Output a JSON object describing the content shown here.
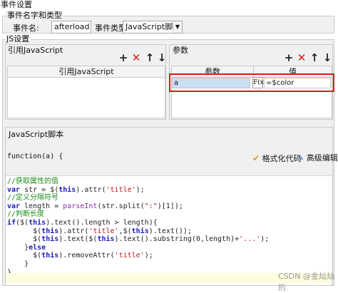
{
  "window": {
    "title": "事件设置"
  },
  "event_group": {
    "legend": "事件名字和类型",
    "name_label": "事件名:",
    "name_value": "afterload",
    "type_label": "事件类型:",
    "type_value": "JavaScript脚本"
  },
  "js_group": {
    "legend": "JS设置",
    "ref_panel": {
      "title": "引用JavaScript",
      "column": "引用JavaScript"
    },
    "param_panel": {
      "title": "参数",
      "columns": [
        "参数",
        "值"
      ],
      "rows": [
        {
          "param": "a",
          "fx": "F(x)",
          "value": "=$color"
        }
      ]
    },
    "toolbar": {
      "add": "+",
      "remove": "✕",
      "up": "↑",
      "down": "↓"
    },
    "script_title": "JavaScript脚本",
    "func_signature": "function(a) {",
    "format_label": "格式化代码",
    "advanced_label": "高级编辑"
  },
  "code_lines": [
    {
      "tokens": [
        {
          "t": "cm",
          "v": "//获取属性的值"
        }
      ]
    },
    {
      "tokens": [
        {
          "t": "kw",
          "v": "var"
        },
        {
          "t": "plain",
          "v": " str = $("
        },
        {
          "t": "kw",
          "v": "this"
        },
        {
          "t": "plain",
          "v": ").attr("
        },
        {
          "t": "st",
          "v": "'title'"
        },
        {
          "t": "plain",
          "v": ");"
        }
      ]
    },
    {
      "tokens": [
        {
          "t": "cm",
          "v": "//定义分隔符号"
        }
      ]
    },
    {
      "tokens": [
        {
          "t": "kw",
          "v": "var"
        },
        {
          "t": "plain",
          "v": " length = "
        },
        {
          "t": "fn",
          "v": "parseInt"
        },
        {
          "t": "plain",
          "v": "(str.split("
        },
        {
          "t": "st",
          "v": "\":\""
        },
        {
          "t": "plain",
          "v": ")[1]);"
        }
      ]
    },
    {
      "tokens": [
        {
          "t": "cm",
          "v": "//判断长度"
        }
      ]
    },
    {
      "tokens": [
        {
          "t": "kw",
          "v": "if"
        },
        {
          "t": "plain",
          "v": "($("
        },
        {
          "t": "kw",
          "v": "this"
        },
        {
          "t": "plain",
          "v": ").text().length > length){"
        }
      ]
    },
    {
      "tokens": [
        {
          "t": "plain",
          "v": "      $("
        },
        {
          "t": "kw",
          "v": "this"
        },
        {
          "t": "plain",
          "v": ").attr("
        },
        {
          "t": "st",
          "v": "'title'"
        },
        {
          "t": "plain",
          "v": ",$("
        },
        {
          "t": "kw",
          "v": "this"
        },
        {
          "t": "plain",
          "v": ").text());"
        }
      ]
    },
    {
      "tokens": [
        {
          "t": "plain",
          "v": "      $("
        },
        {
          "t": "kw",
          "v": "this"
        },
        {
          "t": "plain",
          "v": ").text($("
        },
        {
          "t": "kw",
          "v": "this"
        },
        {
          "t": "plain",
          "v": ").text().substring(0,length)+"
        },
        {
          "t": "st",
          "v": "'...'"
        },
        {
          "t": "plain",
          "v": ");"
        }
      ]
    },
    {
      "tokens": [
        {
          "t": "plain",
          "v": "    }"
        },
        {
          "t": "kw",
          "v": "else"
        }
      ]
    },
    {
      "tokens": [
        {
          "t": "plain",
          "v": "      $("
        },
        {
          "t": "kw",
          "v": "this"
        },
        {
          "t": "plain",
          "v": ").removeAttr("
        },
        {
          "t": "st",
          "v": "'title'"
        },
        {
          "t": "plain",
          "v": ");"
        }
      ]
    },
    {
      "tokens": [
        {
          "t": "plain",
          "v": "    }"
        }
      ]
    },
    {
      "tokens": [
        {
          "t": "plain",
          "v": "}"
        }
      ]
    }
  ],
  "watermark": {
    "text": "CSDN @金灿灿的"
  },
  "colors": {
    "highlight_border": "#e31818",
    "selected_cell": "#c9dff3",
    "last_line": "#fefde0"
  }
}
